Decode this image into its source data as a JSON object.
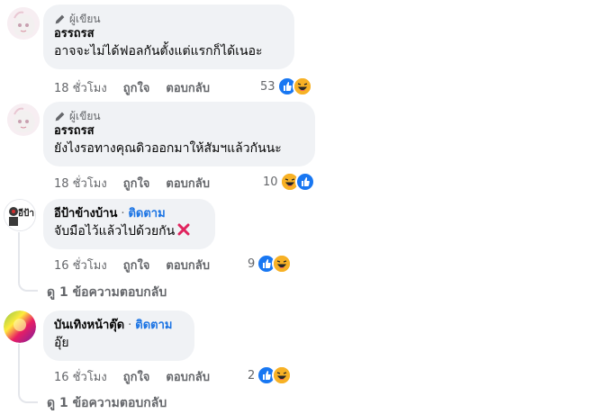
{
  "comments": [
    {
      "badge": "ผู้เขียน",
      "author": "อรรถรส",
      "text": "อาจจะไม่ได้ฟอลกันตั้งแต่แรกก็ได้เนอะ",
      "time": "18 ชั่วโมง",
      "like_label": "ถูกใจ",
      "reply_label": "ตอบกลับ",
      "reaction_count": "53"
    },
    {
      "badge": "ผู้เขียน",
      "author": "อรรถรส",
      "text": "ยังไงรอทางคุณดิวออกมาให้สัมฯแล้วกันนะ",
      "time": "18 ชั่วโมง",
      "like_label": "ถูกใจ",
      "reply_label": "ตอบกลับ",
      "reaction_count": "10"
    },
    {
      "author": "อีป้าข้างบ้าน",
      "follow_label": "ติดตาม",
      "text": "จับมือไว้แล้วไปด้วยกัน",
      "time": "16 ชั่วโมง",
      "like_label": "ถูกใจ",
      "reply_label": "ตอบกลับ",
      "reaction_count": "9",
      "view_replies": "ดู 1 ข้อความตอบกลับ"
    },
    {
      "author": "บันเทิงหน้าตุ๊ด",
      "follow_label": "ติดตาม",
      "text": "อุ๊ย",
      "time": "16 ชั่วโมง",
      "like_label": "ถูกใจ",
      "reply_label": "ตอบกลับ",
      "reaction_count": "2",
      "view_replies": "ดู 1 ข้อความตอบกลับ"
    }
  ],
  "separator": "·",
  "avatar3_text": "อีป้า",
  "colors": {
    "like": "#1877f2",
    "haha": "#f7b125",
    "follow": "#1b74e4",
    "bubble": "#f0f2f5",
    "meta": "#65676b"
  }
}
